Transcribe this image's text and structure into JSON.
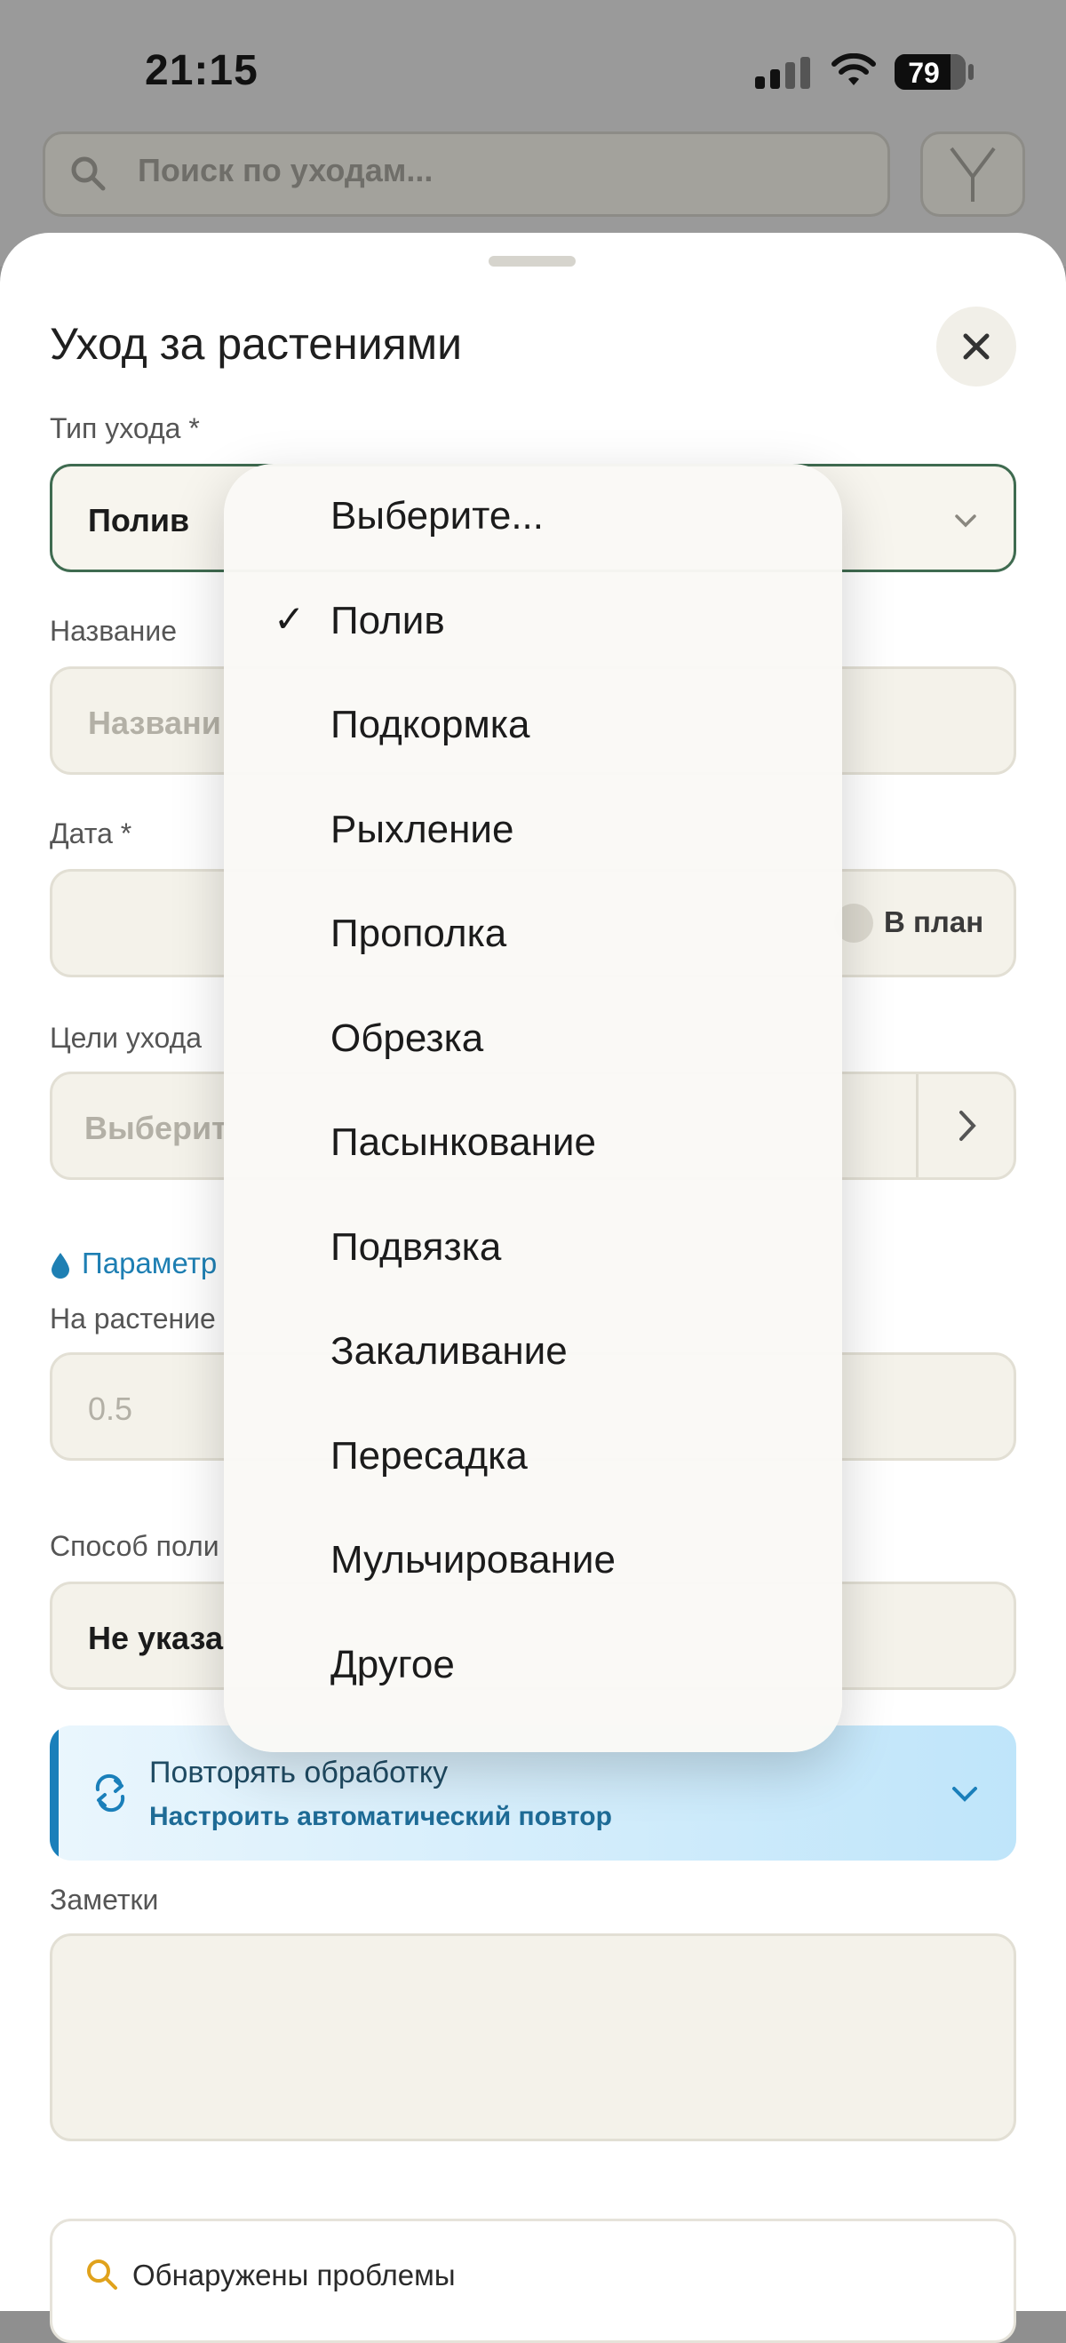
{
  "status_bar": {
    "time": "21:15",
    "battery": "79",
    "battery_level": 0.79
  },
  "background": {
    "search_placeholder": "Поиск по уходам..."
  },
  "sheet": {
    "title": "Уход за растениями",
    "care_type": {
      "label": "Тип ухода *",
      "value": "Полив"
    },
    "name": {
      "label": "Название",
      "placeholder": "Названи"
    },
    "date": {
      "label": "Дата *",
      "plan_label": "В план"
    },
    "goals": {
      "label": "Цели ухода",
      "placeholder": "Выберит"
    },
    "params_link": "Параметр",
    "per_plant": {
      "label": "На растение",
      "value": "0.5"
    },
    "method": {
      "label": "Способ поли",
      "value": "Не указа"
    },
    "repeat": {
      "title": "Повторять обработку",
      "subtitle": "Настроить автоматический повтор"
    },
    "notes": {
      "label": "Заметки"
    },
    "problems": {
      "label": "Обнаружены проблемы"
    }
  },
  "dropdown": {
    "selected": "Полив",
    "options": [
      "Выберите...",
      "Полив",
      "Подкормка",
      "Рыхление",
      "Прополка",
      "Обрезка",
      "Пасынкование",
      "Подвязка",
      "Закаливание",
      "Пересадка",
      "Мульчирование",
      "Другое"
    ]
  },
  "colors": {
    "accent_green": "#3f6b50",
    "link_blue": "#1e7fb3",
    "field_bg": "#f4f2ea"
  }
}
